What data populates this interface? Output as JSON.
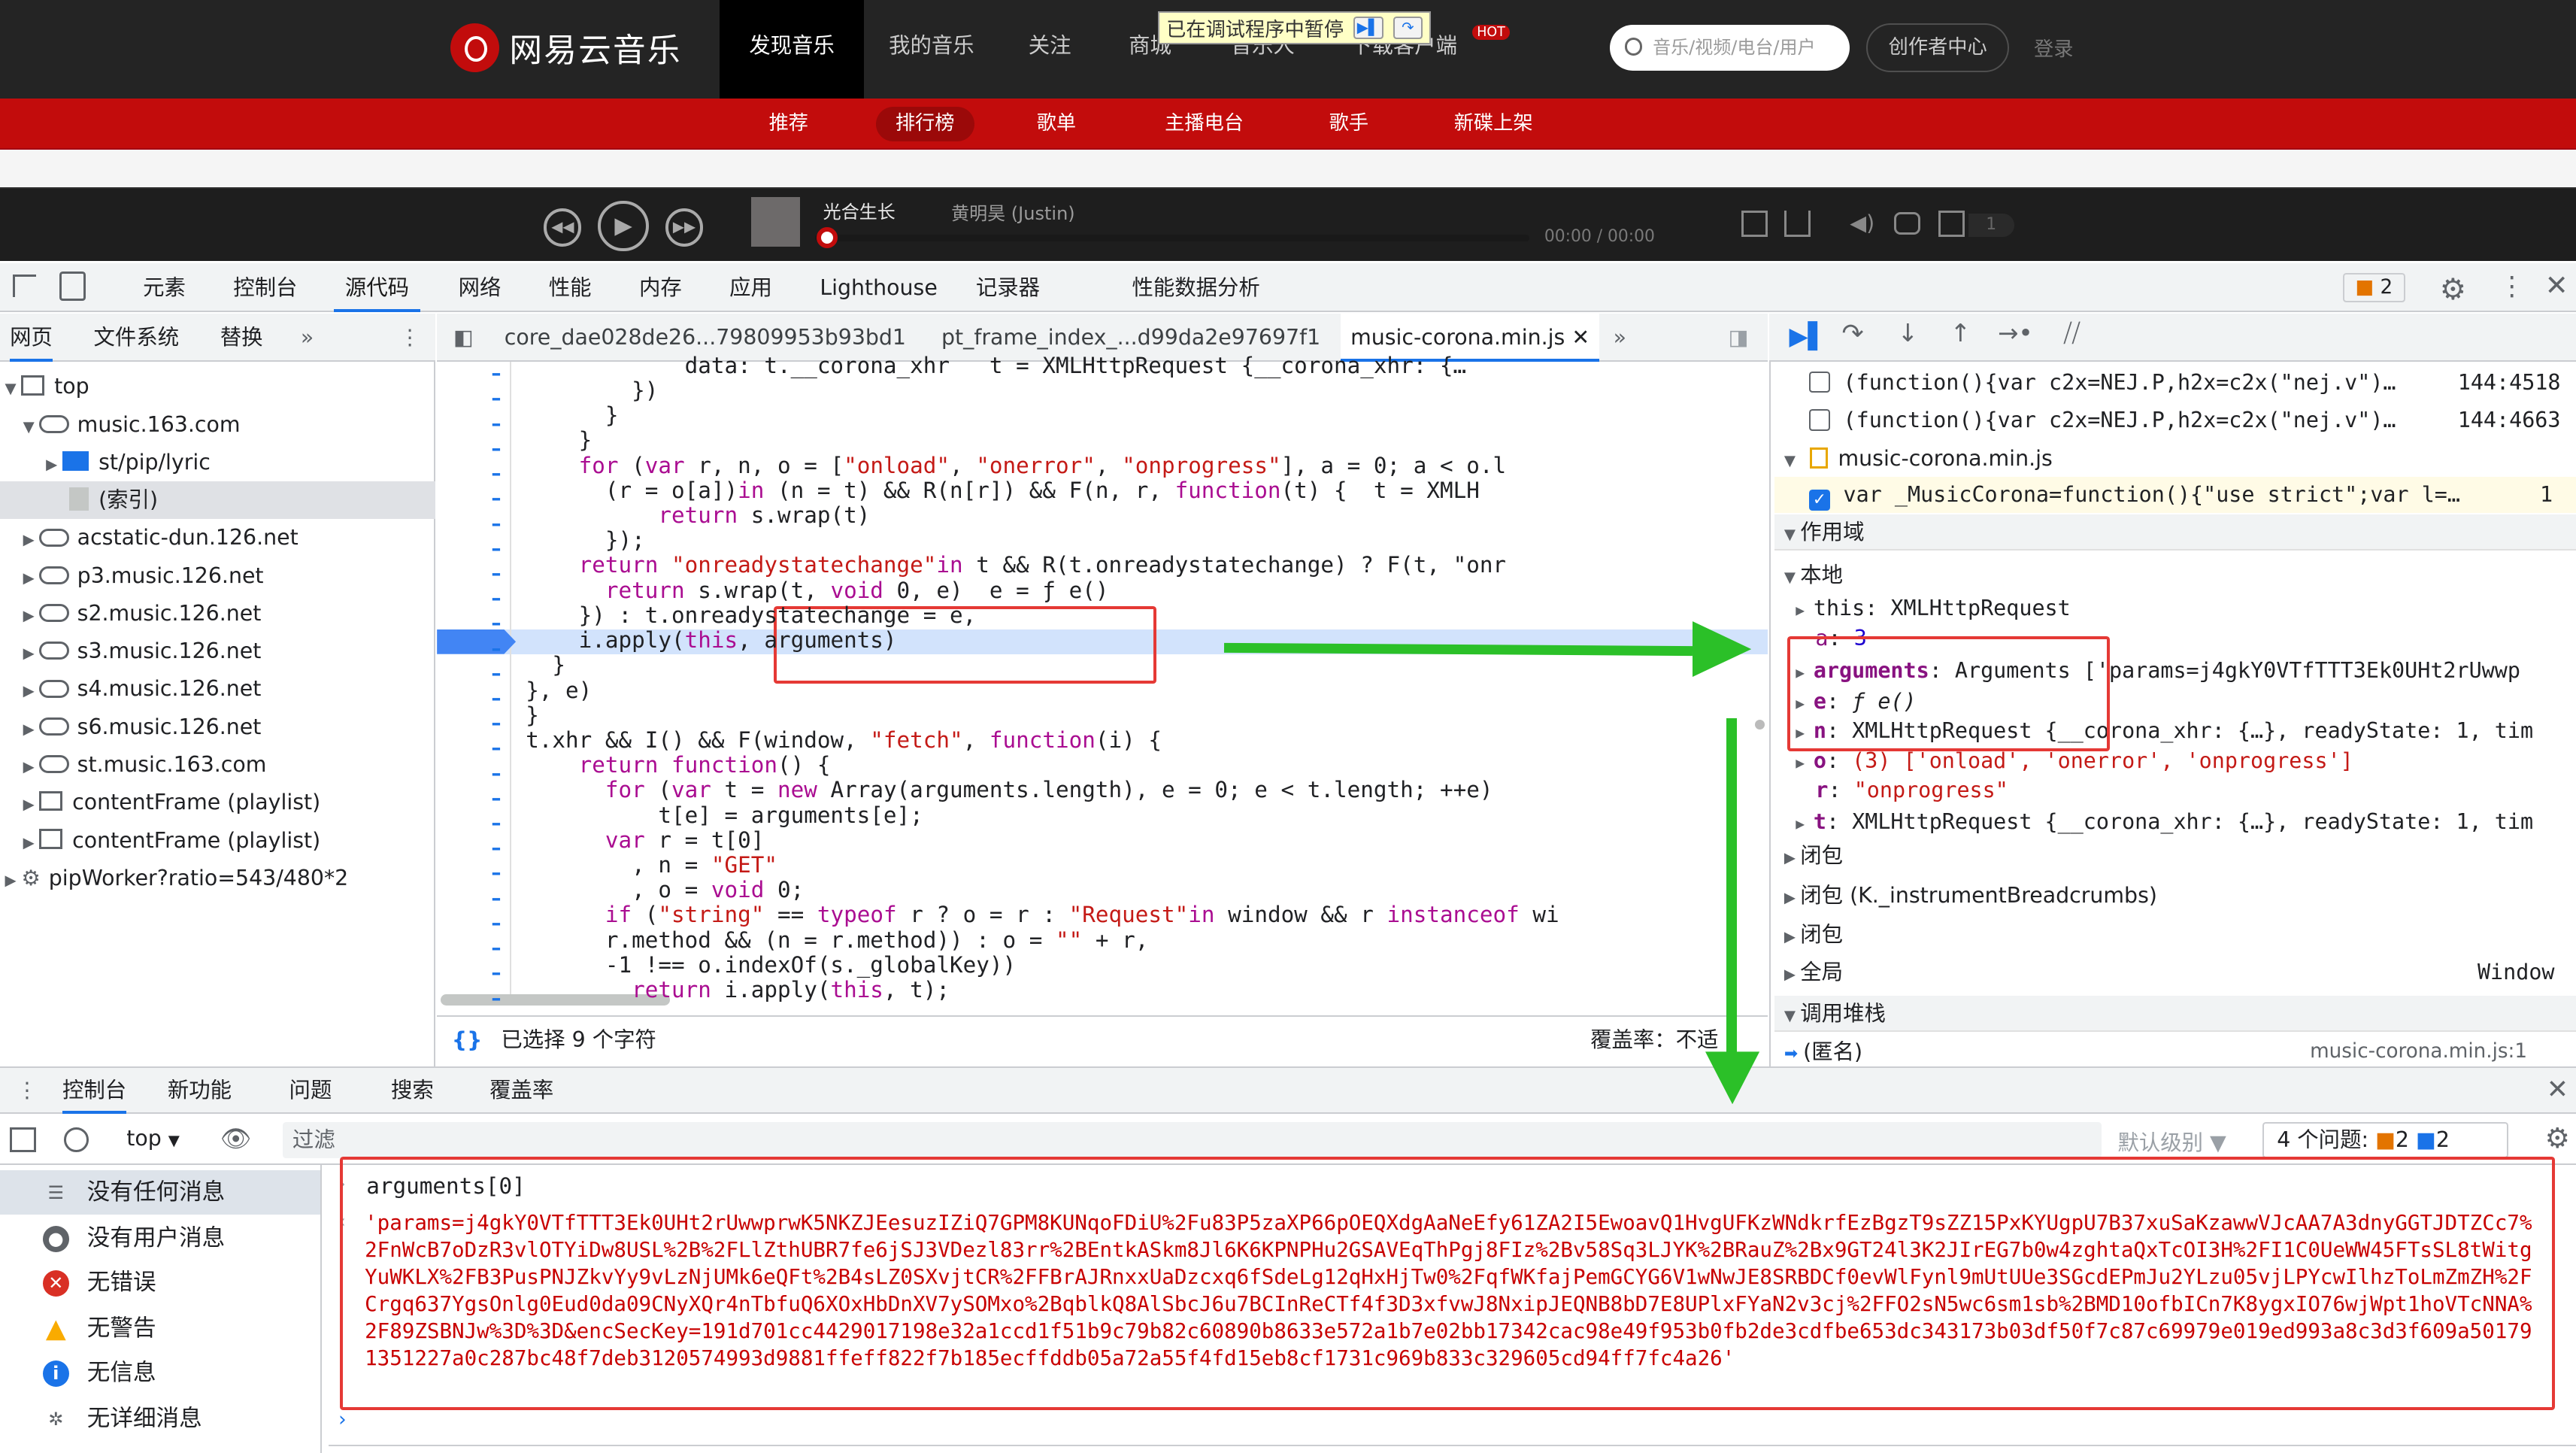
{
  "site": {
    "logo": "网易云音乐",
    "nav": [
      "发现音乐",
      "我的音乐",
      "关注",
      "商城",
      "音乐人",
      "下载客户端"
    ],
    "hot": "HOT",
    "pause_tip": "已在调试程序中暂停",
    "search_placeholder": "音乐/视频/电台/用户",
    "creator": "创作者中心",
    "login": "登录",
    "subnav": [
      "推荐",
      "排行榜",
      "歌单",
      "主播电台",
      "歌手",
      "新碟上架"
    ],
    "player": {
      "song": "光合生长",
      "artist": "黄明昊 (Justin)",
      "time": "00:00 / 00:00",
      "count": "1"
    }
  },
  "devtools": {
    "tabs": [
      "元素",
      "控制台",
      "源代码",
      "网络",
      "性能",
      "内存",
      "应用",
      "Lighthouse",
      "记录器",
      "性能数据分析"
    ],
    "issues": "2",
    "left_tabs": [
      "网页",
      "文件系统",
      "替换"
    ],
    "tree": [
      "top",
      "music.163.com",
      "st/pip/lyric",
      "(索引)",
      "acstatic-dun.126.net",
      "p3.music.126.net",
      "s2.music.126.net",
      "s3.music.126.net",
      "s4.music.126.net",
      "s6.music.126.net",
      "st.music.163.com",
      "contentFrame (playlist)",
      "contentFrame (playlist)",
      "pipWorker?ratio=543/480*2"
    ],
    "editor_tabs": [
      "core_dae028de26...79809953b93bd1",
      "pt_frame_index_...d99da2e97697f1",
      "music-corona.min.js"
    ],
    "status_selected": "已选择 9 个字符",
    "status_coverage": "覆盖率：不适",
    "right": {
      "bp1": "(function(){var c2x=NEJ.P,h2x=c2x(\"nej.v\")…",
      "bp1_loc": "144:4518",
      "bp2": "(function(){var c2x=NEJ.P,h2x=c2x(\"nej.v\")…",
      "bp2_loc": "144:4663",
      "file": "music-corona.min.js",
      "bp3": "var _MusicCorona=function(){\"use strict\";var l=…",
      "bp3_loc": "1",
      "scope": "作用域",
      "local": "本地",
      "this_val": "XMLHttpRequest",
      "a_val": "3",
      "args_val": "Arguments ['params=j4gkY0VTfTTT3Ek0UHt2rUwwp",
      "e_val": "ƒ e()",
      "n_val": "XMLHttpRequest {__corona_xhr: {…}, readyState: 1, tim",
      "o_val": "(3) ['onload', 'onerror', 'onprogress']",
      "r_val": "\"onprogress\"",
      "t_val": "XMLHttpRequest {__corona_xhr: {…}, readyState: 1, tim",
      "closure1": "闭包",
      "closure2": "闭包 (K._instrumentBreadcrumbs)",
      "closure3": "闭包",
      "global": "全局",
      "global_val": "Window",
      "callstack": "调用堆栈",
      "anon": "(匿名)",
      "anon_loc": "music-corona.min.js:1"
    },
    "drawer_tabs": [
      "控制台",
      "新功能",
      "问题",
      "搜索",
      "覆盖率"
    ],
    "console_ctx": "top",
    "filter": "过滤",
    "level": "默认级别",
    "issues_label": "4 个问题:",
    "issues_warn": "2",
    "issues_info": "2",
    "sidebar": [
      "没有任何消息",
      "没有用户消息",
      "无错误",
      "无警告",
      "无信息",
      "无详细消息"
    ],
    "input": "arguments[0]",
    "result": "'params=j4gkY0VTfTTT3Ek0UHt2rUwwprwK5NKZJEesuzIZiQ7GPM8KUNqoFDiU%2Fu83P5zaXP66pOEQXdgAaNeEfy61ZA2I5EwoavQ1HvgUFKzWNdkrfEzBgzT9sZZ15PxKYUgpU7B37xuSaKzawwVJcAA7A3dnyGGTJDTZCc7%2FnWcB7oDzR3vlOTYiDw8USL%2B%2FLlZthUBR7fe6jSJ3VDezl83rr%2BEntkASkm8Jl6K6KPNPHu2GSAVEqThPgj8FIz%2Bv58Sq3LJYK%2BRauZ%2Bx9GT24l3K2JIrEG7b0w4zghtaQxTcOI3H%2FI1C0UeWW45FTsSL8tWitgYuWKLX%2FB3PusPNJZkvYy9vLzNjUMk6eQFt%2B4sLZ0SXvjtCR%2FFBrAJRnxxUaDzcxq6fSdeLg12qHxHjTw0%2FqfWKfajPemGCYG6V1wNwJE8SRBDCf0evWlFynl9mUtUUe3SGcdEPmJu2YLzu05vjLPYcwIlhzToLmZmZH%2FCrgq637YgsOnlg0Eud0da09CNyXQr4nTbfuQ6XOxHbDnXV7ySOMxo%2BqblkQ8AlSbcJ6u7BCInReCTf4f3D3xfvwJ8NxipJEQNB8bD7E8UPlxFYaN2v3cj%2FFO2sN5wc6sm1sb%2BMD10ofbICn7K8ygxIO76wjWpt1hoVTcNNA%2F89ZSBNJw%3D%3D&encSecKey=191d701cc4429017198e32a1ccd1f51b9c79b82c60890b8633e572a1b7e02bb17342cac98e49f953b0fb2de3cdfbe653dc343173b03df50f7c87c69979e019ed993a8c3d3f609a501791351227a0c287bc48f7deb3120574993d9881ffeff822f7b185ecffddb05a72a55f4fd15eb8cf1731c969b833c329605cd94ff7fc4a26'"
  },
  "code": [
    {
      "t": "            data: t.__corona_xhr   t = XMLHttpRequest {__corona_xhr: {…"
    },
    {
      "t": "        })"
    },
    {
      "t": "      }"
    },
    {
      "t": "    }"
    },
    {
      "t": "    for (var r, n, o = [\"onload\", \"onerror\", \"onprogress\"], a = 0; a < o.l"
    },
    {
      "t": "      (r = o[a])in (n = t) && R(n[r]) && F(n, r, function(t) {  t = XMLH"
    },
    {
      "t": "          return s.wrap(t)"
    },
    {
      "t": "      });"
    },
    {
      "t": "    return \"onreadystatechange\"in t && R(t.onreadystatechange) ? F(t, \"onr"
    },
    {
      "t": "      return s.wrap(t, void 0, e)  e = ƒ e()"
    },
    {
      "t": "    }) : t.onreadystatechange = e,"
    },
    {
      "t": "    i.apply(this, arguments)"
    },
    {
      "t": "  }"
    },
    {
      "t": "}, e)"
    },
    {
      "t": "}"
    },
    {
      "t": "t.xhr && I() && F(window, \"fetch\", function(i) {"
    },
    {
      "t": "    return function() {"
    },
    {
      "t": "      for (var t = new Array(arguments.length), e = 0; e < t.length; ++e)"
    },
    {
      "t": "          t[e] = arguments[e];"
    },
    {
      "t": "      var r = t[0]"
    },
    {
      "t": "        , n = \"GET\""
    },
    {
      "t": "        , o = void 0;"
    },
    {
      "t": "      if (\"string\" == typeof r ? o = r : \"Request\"in window && r instanceof wi"
    },
    {
      "t": "      r.method && (n = r.method)) : o = \"\" + r,"
    },
    {
      "t": "      -1 !== o.indexOf(s._globalKey))"
    },
    {
      "t": "        return i.apply(this, t);"
    }
  ]
}
